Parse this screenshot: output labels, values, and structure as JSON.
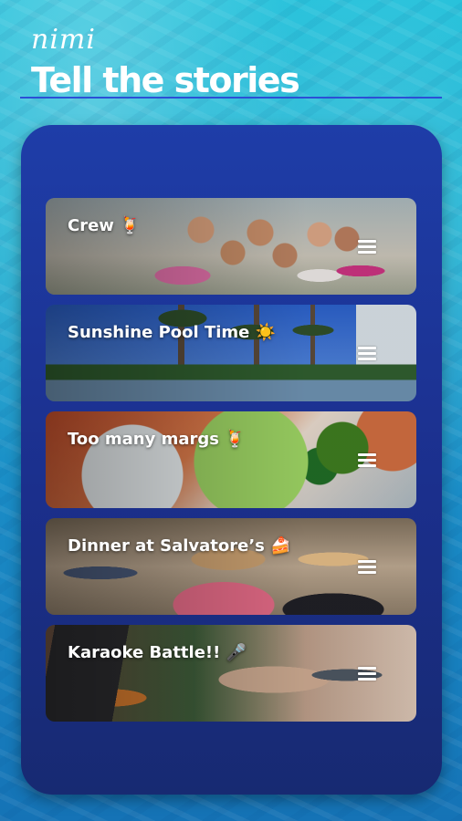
{
  "app": {
    "brand": "nimi",
    "headline": "Tell the stories"
  },
  "stories": [
    {
      "title": "Crew 🍹"
    },
    {
      "title": "Sunshine Pool Time ☀️"
    },
    {
      "title": "Too many margs 🍹"
    },
    {
      "title": "Dinner at Salvatore’s 🍰"
    },
    {
      "title": "Karaoke Battle!! 🎤"
    }
  ],
  "colors": {
    "background": "#1fb1d2",
    "phone_panel": "#1b2f8c",
    "rule": "#2b4fd6",
    "text": "#ffffff"
  },
  "icons": {
    "menu": "hamburger-menu-icon"
  }
}
